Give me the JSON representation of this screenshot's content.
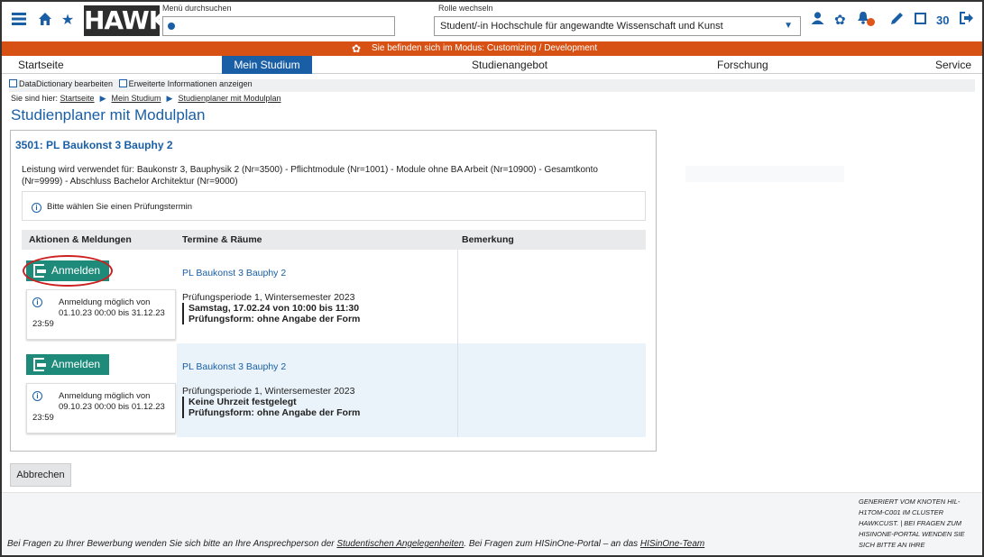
{
  "header": {
    "logo_text": "HAWK",
    "menu_search": {
      "label": "Menü durchsuchen",
      "value": ""
    },
    "role": {
      "label": "Rolle wechseln",
      "selected": "Student/-in Hochschule für angewandte Wissenschaft und Kunst"
    },
    "left_icons": [
      "menu-icon",
      "home-icon",
      "star-icon"
    ],
    "right_icons": [
      "user-icon",
      "gear-icon",
      "notification-bell-icon",
      "edit-pencil-icon",
      "window-icon",
      "logout-icon"
    ],
    "session_minutes": "30",
    "accent_color": "#1a5fa5"
  },
  "mode_bar": {
    "text": "Sie befinden sich im Modus: Customizing / Development",
    "color": "#d65113"
  },
  "nav": {
    "items": [
      "Startseite",
      "Mein Studium",
      "Studienangebot",
      "Forschung",
      "Service"
    ],
    "active": "Mein Studium"
  },
  "options": {
    "datadictionary": "DataDictionary bearbeiten",
    "extended_info": "Erweiterte Informationen anzeigen"
  },
  "breadcrumb": {
    "prefix": "Sie sind hier:",
    "items": [
      "Startseite",
      "Mein Studium",
      "Studienplaner mit Modulplan"
    ]
  },
  "page_title": "Studienplaner mit Modulplan",
  "module": {
    "title": "3501: PL Baukonst 3 Bauphy 2",
    "usage_line1": "Leistung wird verwendet für: Baukonstr 3, Bauphysik 2 (Nr=3500) - Pflichtmodule (Nr=1001) - Module ohne BA Arbeit (Nr=10900) - Gesamtkonto",
    "usage_line2": "(Nr=9999) - Abschluss Bachelor Architektur (Nr=9000)",
    "info": "Bitte wählen Sie einen Prüfungstermin"
  },
  "table": {
    "headers": [
      "Aktionen & Meldungen",
      "Termine & Räume",
      "Bemerkung"
    ],
    "rows": [
      {
        "button": "Anmelden",
        "note_line1": "Anmeldung möglich von",
        "note_line2": "01.10.23 00:00 bis 31.12.23",
        "note_line3": "23:59",
        "link": "PL Baukonst 3 Bauphy 2",
        "period": "Prüfungsperiode 1, Wintersemester 2023",
        "date": "Samstag, 17.02.24 von 10:00 bis 11:30",
        "form": "Prüfungsform: ohne Angabe der Form",
        "remark": ""
      },
      {
        "button": "Anmelden",
        "note_line1": "Anmeldung möglich von",
        "note_line2": "09.10.23 00:00 bis 01.12.23",
        "note_line3": "23:59",
        "link": "PL Baukonst 3 Bauphy 2",
        "period": "Prüfungsperiode 1, Wintersemester 2023",
        "date": "Keine Uhrzeit festgelegt",
        "form": "Prüfungsform: ohne Angabe der Form",
        "remark": ""
      }
    ]
  },
  "cancel_button": "Abbrechen",
  "footer": {
    "text_part1": "Bei Fragen zu Ihrer Bewerbung wenden Sie sich bitte an Ihre Ansprechperson der",
    "link1": "Studentischen Angelegenheiten",
    "text_part2": ". Bei Fragen zum HISinOne-Portal – an das",
    "link2": "HISinOne-Team",
    "right_text": "GENERIERT VOM KNOTEN HIL-H1TOM-C001 IM CLUSTER HAWKCUST. | BEI FRAGEN ZUM HISINONE-PORTAL WENDEN SIE SICH BITTE AN IHRE"
  }
}
